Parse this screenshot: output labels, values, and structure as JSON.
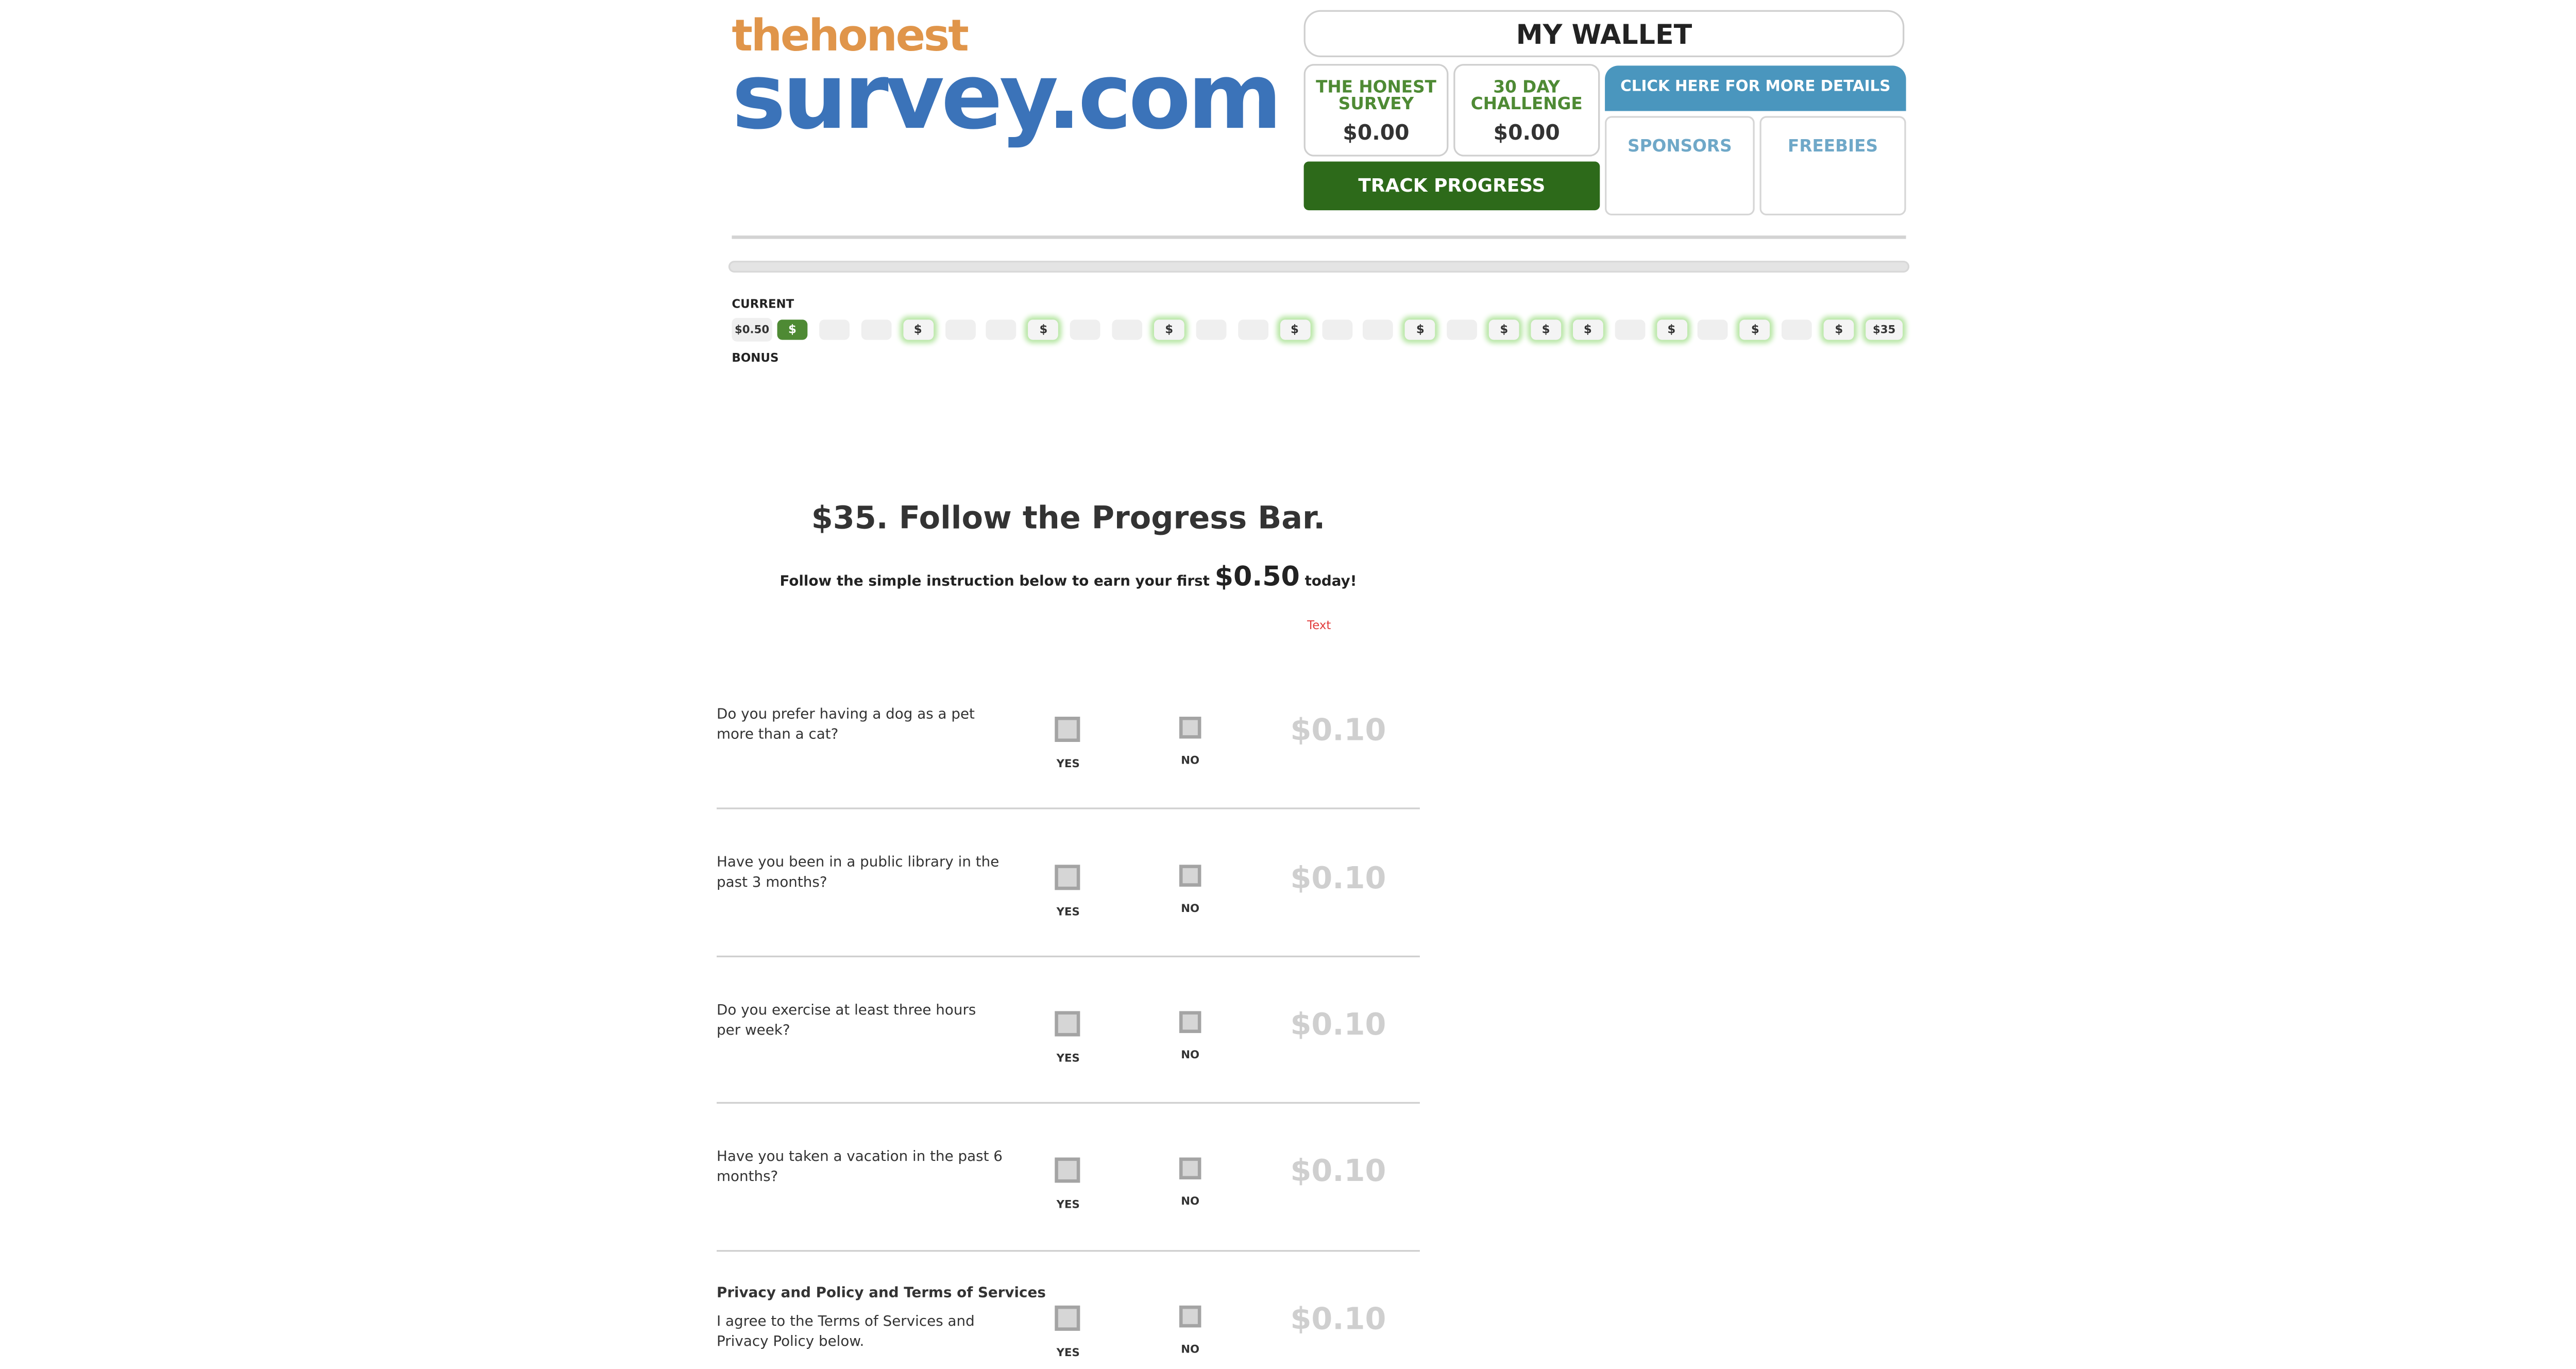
{
  "logo": {
    "top": "thehonest",
    "bottom": "survey.com"
  },
  "wallet": {
    "title": "MY WALLET",
    "survey_label": "THE HONEST SURVEY",
    "survey_amount": "$0.00",
    "challenge_label": "30 DAY CHALLENGE",
    "challenge_amount": "$0.00",
    "details_button": "CLICK HERE FOR MORE DETAILS",
    "sponsors": "SPONSORS",
    "freebies": "FREEBIES",
    "track_button": "TRACK PROGRESS"
  },
  "progress": {
    "current_label": "CURRENT",
    "bonus_label": "BONUS",
    "current_amount": "$0.50",
    "step_symbol": "$",
    "final_label": "$35",
    "progress_fraction": 0.0,
    "steps": [
      {
        "kind": "active"
      },
      {
        "kind": "empty"
      },
      {
        "kind": "empty"
      },
      {
        "kind": "milestone"
      },
      {
        "kind": "empty"
      },
      {
        "kind": "empty"
      },
      {
        "kind": "milestone"
      },
      {
        "kind": "empty"
      },
      {
        "kind": "empty"
      },
      {
        "kind": "milestone"
      },
      {
        "kind": "empty"
      },
      {
        "kind": "empty"
      },
      {
        "kind": "milestone"
      },
      {
        "kind": "empty"
      },
      {
        "kind": "empty"
      },
      {
        "kind": "milestone"
      },
      {
        "kind": "empty"
      },
      {
        "kind": "milestone"
      },
      {
        "kind": "milestone"
      },
      {
        "kind": "milestone"
      },
      {
        "kind": "empty"
      },
      {
        "kind": "milestone"
      },
      {
        "kind": "empty"
      },
      {
        "kind": "milestone"
      },
      {
        "kind": "empty"
      },
      {
        "kind": "milestone"
      },
      {
        "kind": "final"
      }
    ]
  },
  "heading": {
    "title": "$35. Follow the Progress Bar.",
    "sub_before": "Follow the simple instruction below to earn your first ",
    "sub_amount": "$0.50",
    "sub_after": " today!",
    "text_link": "Text"
  },
  "questions": [
    {
      "text": "Do you prefer having a dog as a pet more than a cat?",
      "yes": "YES",
      "no": "NO",
      "amount": "$0.10"
    },
    {
      "text": "Have you been in a public library in the past 3 months?",
      "yes": "YES",
      "no": "NO",
      "amount": "$0.10"
    },
    {
      "text": "Do you exercise at least three hours per week?",
      "yes": "YES",
      "no": "NO",
      "amount": "$0.10"
    },
    {
      "text": "Have you taken a vacation in the past 6 months?",
      "yes": "YES",
      "no": "NO",
      "amount": "$0.10"
    }
  ],
  "terms": {
    "title": "Privacy and Policy and Terms of Services",
    "text": "I agree to the Terms of Services and Privacy Policy below.",
    "yes": "YES",
    "no": "NO",
    "amount": "$0.10"
  }
}
